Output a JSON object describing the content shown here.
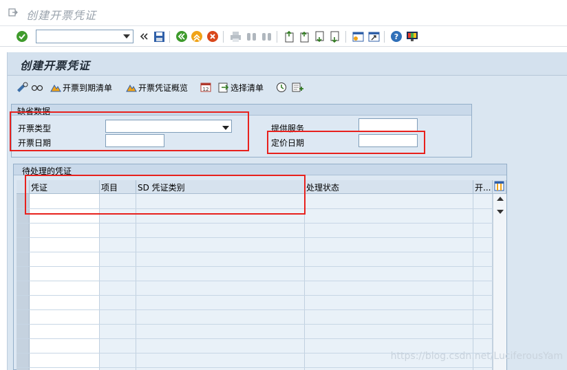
{
  "title": "创建开票凭证",
  "command_field": {
    "value": ""
  },
  "screen_title": "创建开票凭证",
  "app_toolbar": {
    "billing_due_list": "开票到期清单",
    "billing_doc_overview": "开票凭证概览",
    "selection_list": "选择清单"
  },
  "defaults": {
    "title": "缺省数据",
    "billing_type_label": "开票类型",
    "billing_type_value": "",
    "billing_date_label": "开票日期",
    "billing_date_value": "",
    "service_label": "提供服务",
    "service_value": "",
    "pricing_date_label": "定价日期",
    "pricing_date_value": ""
  },
  "table": {
    "title": "待处理的凭证",
    "columns": [
      "凭证",
      "项目",
      "SD 凭证类别",
      "处理状态",
      "开..."
    ],
    "rows": [
      [],
      [],
      [],
      [],
      [],
      [],
      [],
      [],
      [],
      [],
      [],
      []
    ]
  },
  "watermark": "https://blog.csdn.net/LuciferousYam",
  "colors": {
    "highlight": "#e8201c",
    "screen_bg": "#dae6f1",
    "header_bg": "#d6e2ee"
  }
}
